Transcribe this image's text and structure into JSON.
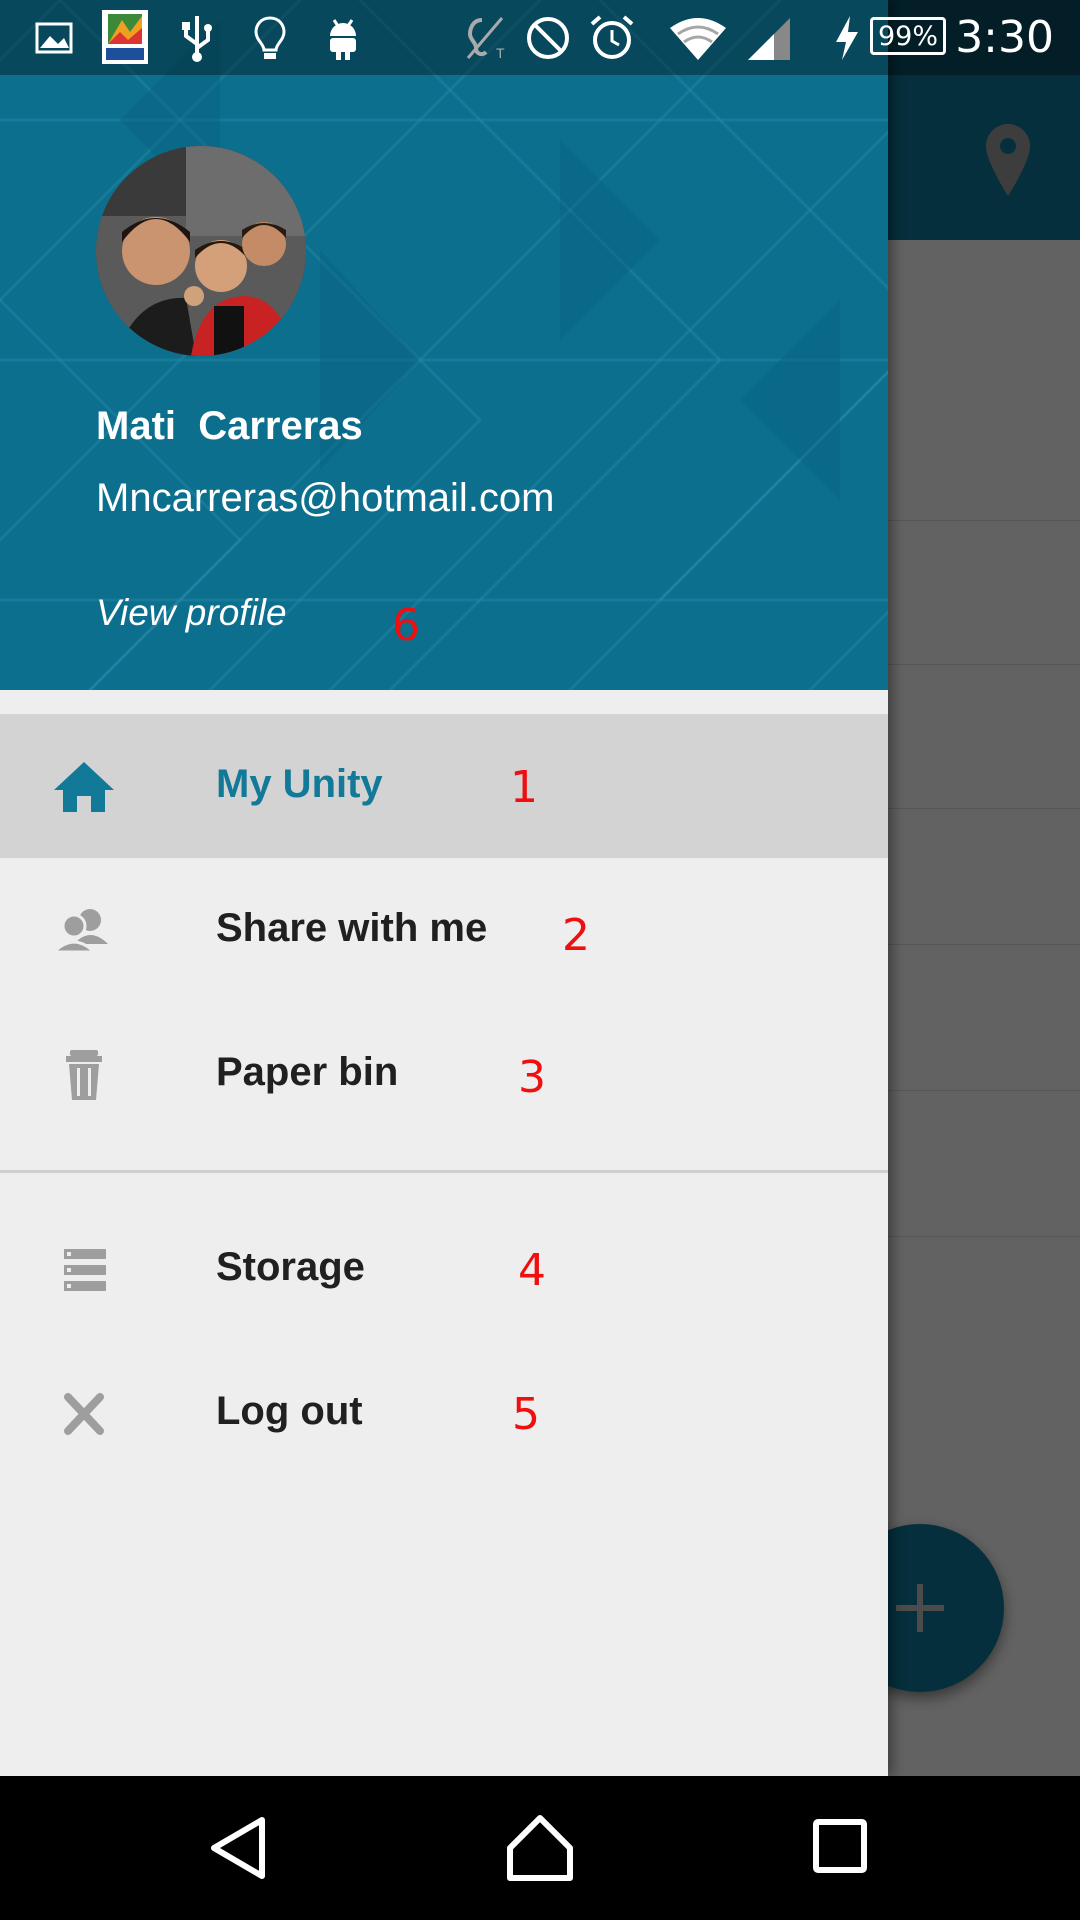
{
  "status_bar": {
    "time": "3:30",
    "battery": "99%",
    "icons": [
      "image-icon",
      "avg-pro-icon",
      "usb-icon",
      "lightbulb-icon",
      "android-icon",
      "hearing-aid-icon",
      "block-icon",
      "alarm-icon",
      "wifi-icon",
      "signal-icon",
      "charging-icon"
    ]
  },
  "drawer": {
    "header": {
      "name": "Mati  Carreras",
      "email": "Mncarreras@hotmail.com",
      "view_profile": "View profile"
    },
    "items": [
      {
        "label": "My Unity",
        "icon": "home-icon",
        "annotation": "1",
        "active": true
      },
      {
        "label": "Share with me",
        "icon": "people-icon",
        "annotation": "2"
      },
      {
        "label": "Paper bin",
        "icon": "trash-icon",
        "annotation": "3"
      },
      {
        "label": "Storage",
        "icon": "storage-icon",
        "annotation": "4"
      },
      {
        "label": "Log out",
        "icon": "close-icon",
        "annotation": "5"
      }
    ],
    "profile_annotation": "6"
  },
  "colors": {
    "accent": "#127a98",
    "header": "#0c6f8e",
    "annotation": "#ef0f0f"
  }
}
